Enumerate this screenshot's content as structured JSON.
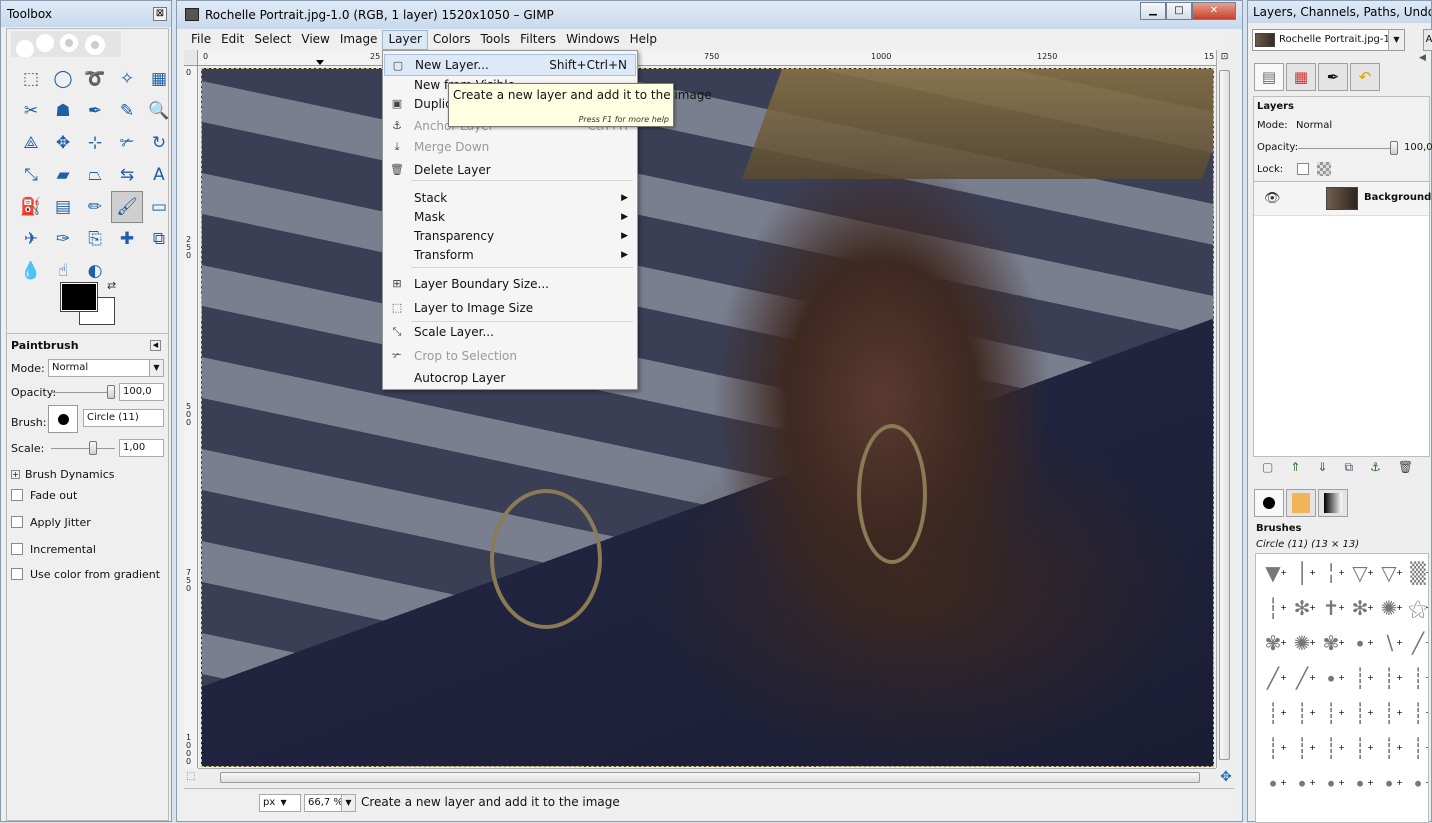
{
  "toolbox": {
    "title": "Toolbox",
    "close_glyph": "⊠",
    "tools": [
      {
        "name": "rect-select-icon",
        "glyph": "⬚"
      },
      {
        "name": "ellipse-select-icon",
        "glyph": "◯"
      },
      {
        "name": "free-select-icon",
        "glyph": "➰"
      },
      {
        "name": "fuzzy-select-icon",
        "glyph": "✧"
      },
      {
        "name": "color-select-icon",
        "glyph": "▦"
      },
      {
        "name": "scissors-icon",
        "glyph": "✂"
      },
      {
        "name": "foreground-select-icon",
        "glyph": "☗"
      },
      {
        "name": "paths-icon",
        "glyph": "✒"
      },
      {
        "name": "color-picker-icon",
        "glyph": "✎"
      },
      {
        "name": "zoom-icon",
        "glyph": "🔍"
      },
      {
        "name": "measure-icon",
        "glyph": "⟁"
      },
      {
        "name": "move-icon",
        "glyph": "✥"
      },
      {
        "name": "align-icon",
        "glyph": "⊹"
      },
      {
        "name": "crop-icon",
        "glyph": "✃"
      },
      {
        "name": "rotate-icon",
        "glyph": "↻"
      },
      {
        "name": "scale-icon",
        "glyph": "⤡"
      },
      {
        "name": "shear-icon",
        "glyph": "▰"
      },
      {
        "name": "perspective-icon",
        "glyph": "⏢"
      },
      {
        "name": "flip-icon",
        "glyph": "⇆"
      },
      {
        "name": "text-icon",
        "glyph": "A"
      },
      {
        "name": "bucket-fill-icon",
        "glyph": "⛽"
      },
      {
        "name": "blend-icon",
        "glyph": "▤"
      },
      {
        "name": "pencil-icon",
        "glyph": "✏"
      },
      {
        "name": "paintbrush-icon",
        "glyph": "🖌"
      },
      {
        "name": "eraser-icon",
        "glyph": "▭"
      },
      {
        "name": "airbrush-icon",
        "glyph": "✈"
      },
      {
        "name": "ink-icon",
        "glyph": "✑"
      },
      {
        "name": "clone-icon",
        "glyph": "⎘"
      },
      {
        "name": "heal-icon",
        "glyph": "✚"
      },
      {
        "name": "perspective-clone-icon",
        "glyph": "⧉"
      },
      {
        "name": "blur-icon",
        "glyph": "💧"
      },
      {
        "name": "smudge-icon",
        "glyph": "☝"
      },
      {
        "name": "dodge-burn-icon",
        "glyph": "◐"
      }
    ],
    "swap_glyph": "⇄",
    "options": {
      "title": "Paintbrush",
      "mode_label": "Mode:",
      "mode_value": "Normal",
      "opacity_label": "Opacity:",
      "opacity_value": "100,0",
      "opacity_level": 1.0,
      "brush_label": "Brush:",
      "brush_value": "Circle (11)",
      "scale_label": "Scale:",
      "scale_value": "1,00",
      "dynamics_label": "Brush Dynamics",
      "fade_out": "Fade out",
      "apply_jitter": "Apply Jitter",
      "incremental": "Incremental",
      "use_color_gradient": "Use color from gradient"
    }
  },
  "image_window": {
    "title": "Rochelle Portrait.jpg-1.0 (RGB, 1 layer) 1520x1050 – GIMP",
    "menu": [
      "File",
      "Edit",
      "Select",
      "View",
      "Image",
      "Layer",
      "Colors",
      "Tools",
      "Filters",
      "Windows",
      "Help"
    ],
    "ruler_h": [
      "0",
      "25",
      "750",
      "1000",
      "1250",
      "15"
    ],
    "ruler_v": [
      "0",
      "2 5 0",
      "5 0 0",
      "7 5 0",
      "1 0 0 0"
    ],
    "status": {
      "unit": "px",
      "zoom": "66,7 %",
      "message": "Create a new layer and add it to the image"
    }
  },
  "layer_menu": {
    "items": [
      {
        "label": "New Layer...",
        "shortcut": "Shift+Ctrl+N",
        "icon": "new-layer-icon",
        "glyph": "▢"
      },
      {
        "label": "New from Visible",
        "icon": "",
        "glyph": ""
      },
      {
        "label": "Duplicate Layer",
        "icon": "duplicate-layer-icon",
        "glyph": "▣"
      },
      {
        "label": "Anchor Layer",
        "shortcut": "Ctrl+H",
        "icon": "anchor-icon",
        "glyph": "⚓"
      },
      {
        "label": "Merge Down",
        "icon": "merge-down-icon",
        "glyph": "⤓"
      },
      {
        "label": "Delete Layer",
        "icon": "delete-layer-icon",
        "glyph": "🗑"
      },
      {
        "label": "Stack"
      },
      {
        "label": "Mask"
      },
      {
        "label": "Transparency"
      },
      {
        "label": "Transform"
      },
      {
        "label": "Layer Boundary Size...",
        "icon": "layer-boundary-icon",
        "glyph": "⊞"
      },
      {
        "label": "Layer to Image Size",
        "icon": "layer-to-image-icon",
        "glyph": "⬚"
      },
      {
        "label": "Scale Layer...",
        "icon": "scale-layer-icon",
        "glyph": "⤡"
      },
      {
        "label": "Crop to Selection",
        "icon": "crop-selection-icon",
        "glyph": "✃"
      },
      {
        "label": "Autocrop Layer"
      }
    ],
    "submenu_glyph": "▶",
    "tooltip": "Create a new layer and add it to the image",
    "tooltip_help": "Press F1 for more help"
  },
  "dock": {
    "title": "Layers, Channels, Paths, Undo - B...",
    "image_select": "Rochelle Portrait.jpg-1",
    "auto_label": "A",
    "layers_title": "Layers",
    "mode_label": "Mode:",
    "mode_value": "Normal",
    "opacity_label": "Opacity:",
    "opacity_value": "100,0",
    "opacity_level": 1.0,
    "lock_label": "Lock:",
    "layer_name": "Background",
    "brushes_title": "Brushes",
    "brush_info": "Circle (11) (13 × 13)"
  }
}
